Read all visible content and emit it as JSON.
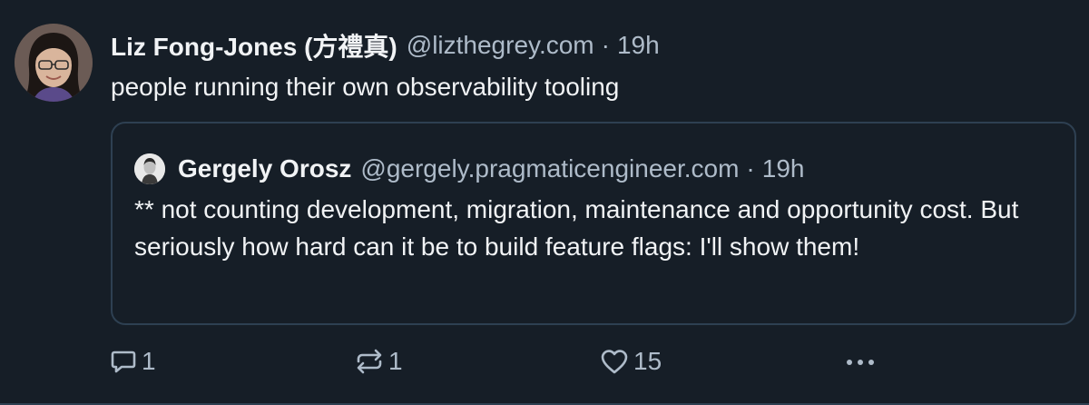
{
  "post": {
    "author": {
      "name": "Liz Fong-Jones (方禮真)",
      "handle": "@lizthegrey.com",
      "time": "19h"
    },
    "separator": "·",
    "text": "people running their own observability tooling"
  },
  "quote": {
    "author": {
      "name": "Gergely Orosz",
      "handle": "@gergely.pragmaticengineer.com",
      "time": "19h"
    },
    "separator": "·",
    "text": "** not counting development, migration, maintenance and opportunity cost. But seriously how hard can it be to build feature flags: I'll show them!"
  },
  "actions": {
    "reply_count": "1",
    "repost_count": "1",
    "like_count": "15",
    "icons": [
      "reply-icon",
      "repost-icon",
      "like-icon",
      "more-icon"
    ]
  },
  "colors": {
    "background": "#161e27",
    "text": "#f1f3f5",
    "muted": "#aebbc9",
    "border": "#2e4052"
  }
}
